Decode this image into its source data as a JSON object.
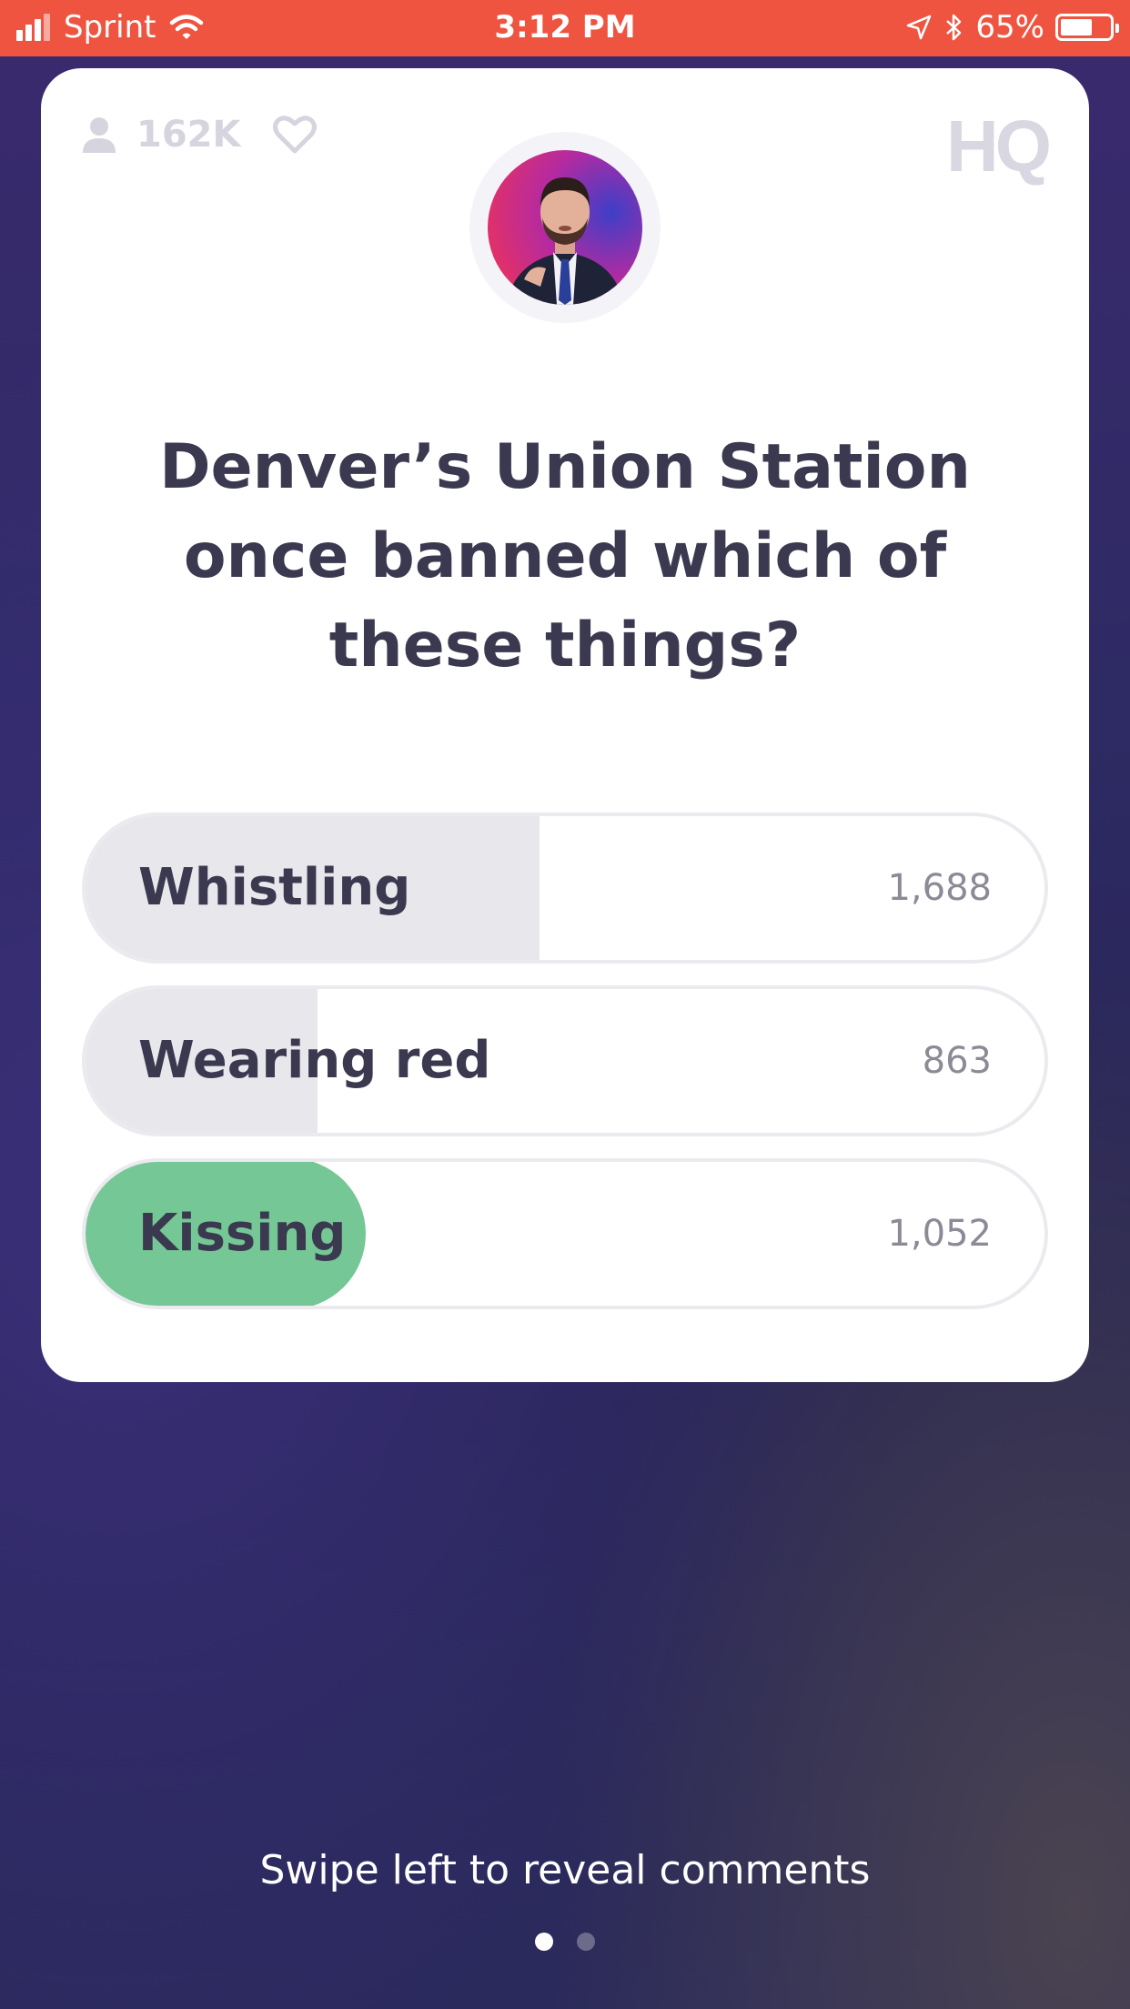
{
  "status_bar": {
    "carrier": "Sprint",
    "time": "3:12 PM",
    "battery_percent": "65%",
    "battery_level": 0.65,
    "icons": [
      "signal-icon",
      "wifi-icon",
      "location-arrow-icon",
      "bluetooth-icon",
      "battery-icon"
    ]
  },
  "card": {
    "viewer_count": "162K",
    "logo": "HQ",
    "question": "Denver’s Union Station once banned which of these things?",
    "answers": [
      {
        "label": "Whistling",
        "count": "1,688",
        "share": 0.47,
        "correct": false
      },
      {
        "label": "Wearing red",
        "count": "863",
        "share": 0.24,
        "correct": false
      },
      {
        "label": "Kissing",
        "count": "1,052",
        "share": 0.29,
        "correct": true
      }
    ]
  },
  "colors": {
    "status_bar": "#ef5440",
    "correct_answer": "#75c795",
    "answer_fill": "#e8e7ec",
    "question_text": "#3b3950"
  },
  "footer": {
    "swipe_hint": "Swipe left to reveal comments",
    "page_count": 2,
    "active_page": 1
  }
}
